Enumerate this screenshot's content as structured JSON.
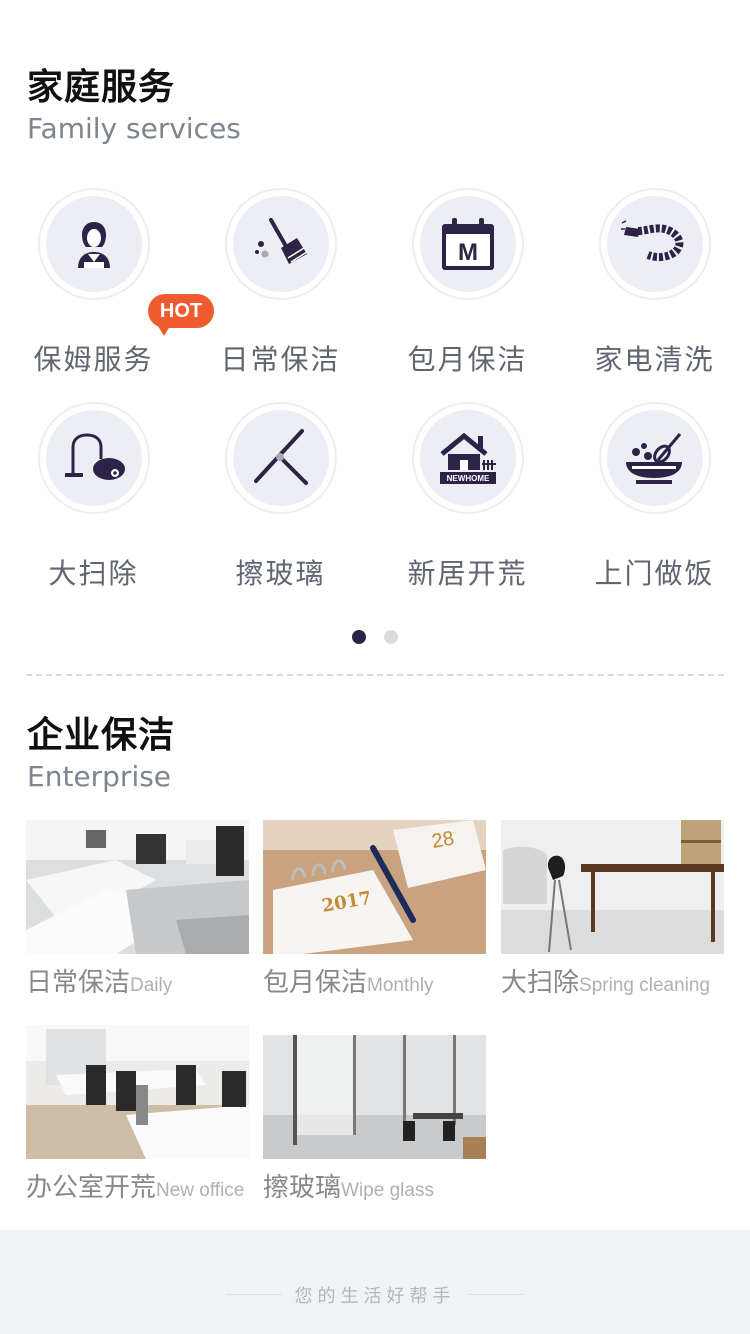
{
  "family": {
    "title": "家庭服务",
    "subtitle": "Family services",
    "services": [
      {
        "label": "保姆服务",
        "icon": "nanny-icon"
      },
      {
        "label": "日常保洁",
        "icon": "broom-icon"
      },
      {
        "label": "包月保洁",
        "icon": "calendar-icon"
      },
      {
        "label": "家电清洗",
        "icon": "hose-icon"
      },
      {
        "label": "大扫除",
        "icon": "vacuum-icon"
      },
      {
        "label": "擦玻璃",
        "icon": "squeegee-icon"
      },
      {
        "label": "新居开荒",
        "icon": "new-home-icon"
      },
      {
        "label": "上门做饭",
        "icon": "cooking-bowl-icon"
      }
    ],
    "hot_badge": "HOT",
    "new_home_text": "NEWHOME",
    "calendar_letter": "M",
    "page_indicator": {
      "current": 1,
      "total": 2
    }
  },
  "enterprise": {
    "title": "企业保洁",
    "subtitle": "Enterprise",
    "items": [
      {
        "zh": "日常保洁",
        "en": "Daily"
      },
      {
        "zh": "包月保洁",
        "en": "Monthly"
      },
      {
        "zh": "大扫除",
        "en": "Spring cleaning"
      },
      {
        "zh": "办公室开荒",
        "en": "New office"
      },
      {
        "zh": "擦玻璃",
        "en": "Wipe glass"
      }
    ],
    "calendar_year": "2017",
    "calendar_day": "28"
  },
  "footer": {
    "slogan": "您的生活好帮手"
  },
  "colors": {
    "accent": "#2d2347",
    "hot": "#ef5a2f",
    "disc": "#edeef5",
    "dot_active": "#2d2347",
    "dot_inactive": "#dddddd"
  }
}
